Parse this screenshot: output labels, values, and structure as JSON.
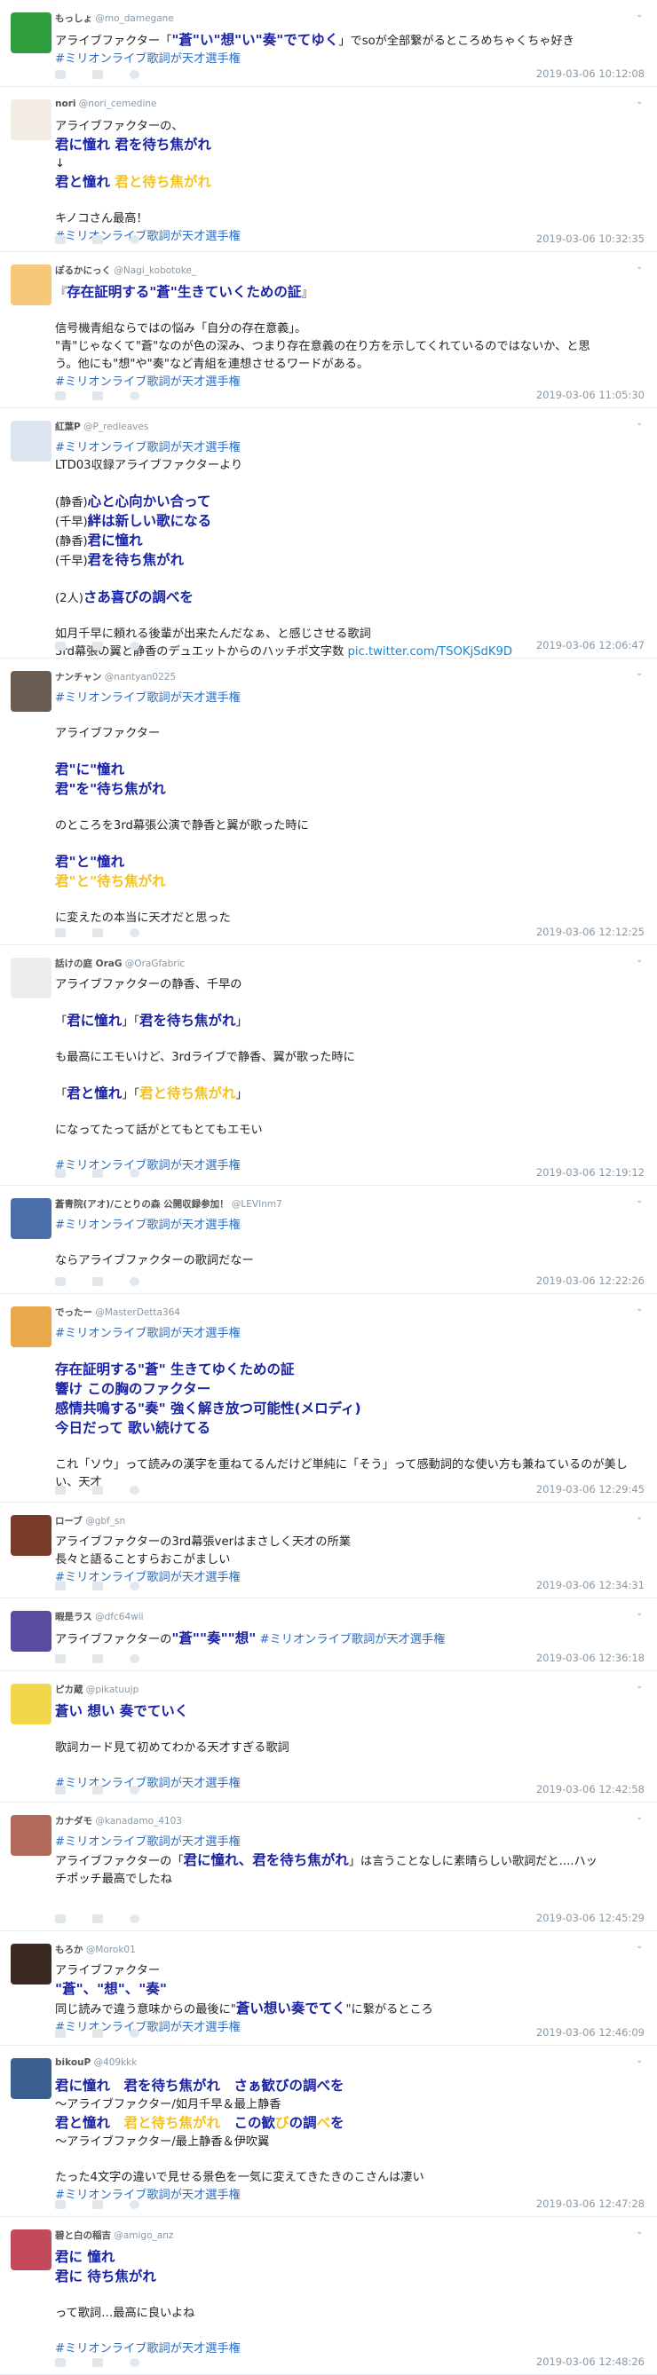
{
  "timeline": {
    "tweets": [
      {
        "user_name": "もっしょ",
        "user_handle": "@mo_damegane",
        "avatar_color": "#2e9d3e",
        "lines": [
          [
            {
              "t": "アライブファクター「"
            },
            {
              "t": "\"蒼\"い\"想\"い\"奏\"でてゆく",
              "s": "blue"
            },
            {
              "t": "」でsoが全部繋がるところめちゃくちゃ好き"
            }
          ],
          [
            {
              "t": "#ミリオンライブ歌詞が天才選手権",
              "s": "tag"
            }
          ]
        ],
        "timestamp": "2019-03-06 10:12:08"
      },
      {
        "user_name": "nori",
        "user_handle": "@nori_cemedine",
        "avatar_color": "#f3ede6",
        "lines": [
          [
            {
              "t": "アライブファクターの、"
            }
          ],
          [
            {
              "t": "君に憧れ 君を待ち焦がれ",
              "s": "blue"
            }
          ],
          [
            {
              "t": "↓"
            }
          ],
          [
            {
              "t": "君と憧れ ",
              "s": "blue"
            },
            {
              "t": "君と待ち焦がれ",
              "s": "yel"
            }
          ],
          [
            {
              "t": ""
            }
          ],
          [
            {
              "t": "キノコさん最高！"
            }
          ],
          [
            {
              "t": "#ミリオンライブ歌詞が天才選手権",
              "s": "tag"
            }
          ]
        ],
        "timestamp": "2019-03-06 10:32:35"
      },
      {
        "user_name": "ぽるかにっく",
        "user_handle": "@Nagi_kobotoke_",
        "avatar_color": "#f6c97a",
        "lines": [
          [
            {
              "t": "『"
            },
            {
              "t": "存在証明する\"蒼\"生きていくための証",
              "s": "blue"
            },
            {
              "t": "』"
            }
          ],
          [
            {
              "t": ""
            }
          ],
          [
            {
              "t": "信号機青組ならではの悩み「自分の存在意義」。"
            }
          ],
          [
            {
              "t": "\"青\"じゃなくて\"蒼\"なのが色の深み、つまり存在意義の在り方を示してくれているのではないか、と思"
            }
          ],
          [
            {
              "t": "う。他にも\"想\"や\"奏\"など青組を連想させるワードがある。"
            }
          ],
          [
            {
              "t": " #ミリオンライブ歌詞が天才選手権",
              "s": "tag"
            }
          ]
        ],
        "timestamp": "2019-03-06 11:05:30"
      },
      {
        "user_name": "紅葉P",
        "user_handle": "@P_redleaves",
        "avatar_color": "#dbe4ef",
        "lines": [
          [
            {
              "t": "#ミリオンライブ歌詞が天才選手権",
              "s": "tag"
            }
          ],
          [
            {
              "t": "LTD03収録アライブファクターより"
            }
          ],
          [
            {
              "t": ""
            }
          ],
          [
            {
              "t": "(静香)"
            },
            {
              "t": "心と心向かい合って",
              "s": "blue"
            }
          ],
          [
            {
              "t": "(千早)"
            },
            {
              "t": "絆は新しい歌になる",
              "s": "blue"
            }
          ],
          [
            {
              "t": "(静香)"
            },
            {
              "t": "君に憧れ",
              "s": "blue"
            }
          ],
          [
            {
              "t": "(千早)"
            },
            {
              "t": "君を待ち焦がれ",
              "s": "blue"
            }
          ],
          [
            {
              "t": ""
            }
          ],
          [
            {
              "t": "(2人)"
            },
            {
              "t": "さあ喜びの調べを",
              "s": "blue"
            }
          ],
          [
            {
              "t": ""
            }
          ],
          [
            {
              "t": "如月千早に頼れる後輩が出来たんだなぁ、と感じさせる歌詞"
            }
          ],
          [
            {
              "t": "3rd幕張の翼と静香のデュエットからのハッチポ文字数 "
            },
            {
              "t": "pic.twitter.com/TSOKjSdK9D",
              "s": "link"
            }
          ]
        ],
        "timestamp": "2019-03-06 12:06:47"
      },
      {
        "user_name": "ナンチャン",
        "user_handle": "@nantyan0225",
        "avatar_color": "#6b5c52",
        "lines": [
          [
            {
              "t": "#ミリオンライブ歌詞が天才選手権",
              "s": "tag"
            }
          ],
          [
            {
              "t": ""
            }
          ],
          [
            {
              "t": "アライブファクター"
            }
          ],
          [
            {
              "t": ""
            }
          ],
          [
            {
              "t": "君\"に\"憧れ",
              "s": "blue"
            }
          ],
          [
            {
              "t": "君\"を\"待ち焦がれ",
              "s": "blue"
            }
          ],
          [
            {
              "t": ""
            }
          ],
          [
            {
              "t": "のところを3rd幕張公演で静香と翼が歌った時に"
            }
          ],
          [
            {
              "t": ""
            }
          ],
          [
            {
              "t": "君\"と\"憧れ",
              "s": "blue"
            }
          ],
          [
            {
              "t": "君\"と\"待ち焦がれ",
              "s": "yel"
            }
          ],
          [
            {
              "t": ""
            }
          ],
          [
            {
              "t": "に変えたの本当に天才だと思った"
            }
          ]
        ],
        "timestamp": "2019-03-06 12:12:25"
      },
      {
        "user_name": "話けの庭 OraG",
        "user_handle": "@OraGfabric",
        "avatar_color": "#ececec",
        "lines": [
          [
            {
              "t": "アライブファクターの静香、千早の"
            }
          ],
          [
            {
              "t": ""
            }
          ],
          [
            {
              "t": "「"
            },
            {
              "t": "君に憧れ",
              "s": "blue"
            },
            {
              "t": "」「"
            },
            {
              "t": "君を待ち焦がれ",
              "s": "blue"
            },
            {
              "t": "」"
            }
          ],
          [
            {
              "t": ""
            }
          ],
          [
            {
              "t": "も最高にエモいけど、3rdライブで静香、翼が歌った時に"
            }
          ],
          [
            {
              "t": ""
            }
          ],
          [
            {
              "t": "「"
            },
            {
              "t": "君と憧れ",
              "s": "blue"
            },
            {
              "t": "」「"
            },
            {
              "t": "君と待ち焦がれ",
              "s": "yel"
            },
            {
              "t": "」"
            }
          ],
          [
            {
              "t": ""
            }
          ],
          [
            {
              "t": "になってたって話がとてもとてもエモい"
            }
          ],
          [
            {
              "t": ""
            }
          ],
          [
            {
              "t": "#ミリオンライブ歌詞が天才選手権",
              "s": "tag"
            }
          ]
        ],
        "timestamp": "2019-03-06 12:19:12"
      },
      {
        "user_name": "蒼青院(アオ)/ことりの森 公開収録参加！",
        "user_handle": "@LEVInm7",
        "avatar_color": "#4a6ea8",
        "lines": [
          [
            {
              "t": "#ミリオンライブ歌詞が天才選手権",
              "s": "tag"
            }
          ],
          [
            {
              "t": ""
            }
          ],
          [
            {
              "t": "ならアライブファクターの歌詞だなー"
            }
          ]
        ],
        "timestamp": "2019-03-06 12:22:26"
      },
      {
        "user_name": "でったー",
        "user_handle": "@MasterDetta364",
        "avatar_color": "#e8a94a",
        "lines": [
          [
            {
              "t": "#ミリオンライブ歌詞が天才選手権",
              "s": "tag"
            }
          ],
          [
            {
              "t": ""
            }
          ],
          [
            {
              "t": "存在証明する\"蒼\" 生きてゆくための証",
              "s": "blue"
            }
          ],
          [
            {
              "t": "響け この胸のファクター",
              "s": "blue"
            }
          ],
          [
            {
              "t": "感情共鳴する\"奏\" 強く解き放つ可能性(メロディ)",
              "s": "blue"
            }
          ],
          [
            {
              "t": "今日だって 歌い続けてる",
              "s": "blue"
            }
          ],
          [
            {
              "t": ""
            }
          ],
          [
            {
              "t": "これ「ソウ」って読みの漢字を重ねてるんだけど単純に「そう」って感動詞的な使い方も兼ねているのが美し"
            }
          ],
          [
            {
              "t": "い、天才"
            }
          ]
        ],
        "timestamp": "2019-03-06 12:29:45"
      },
      {
        "user_name": "ローブ",
        "user_handle": "@gbf_sn",
        "avatar_color": "#7a3a2a",
        "lines": [
          [
            {
              "t": "アライブファクターの3rd幕張verはまさしく天才の所業"
            }
          ],
          [
            {
              "t": "長々と語ることすらおこがましい"
            }
          ],
          [
            {
              "t": "#ミリオンライブ歌詞が天才選手権",
              "s": "tag"
            }
          ]
        ],
        "timestamp": "2019-03-06 12:34:31"
      },
      {
        "user_name": "暇是ラス",
        "user_handle": "@dfc64wii",
        "avatar_color": "#5a4aa0",
        "lines": [
          [
            {
              "t": "アライブファクターの"
            },
            {
              "t": "\"蒼\"\"奏\"\"想\"",
              "s": "blue"
            },
            {
              "t": " "
            },
            {
              "t": "#ミリオンライブ歌詞が天才選手権",
              "s": "tag"
            }
          ]
        ],
        "timestamp": "2019-03-06 12:36:18"
      },
      {
        "user_name": "ピカ蔵",
        "user_handle": "@pikatuujp",
        "avatar_color": "#f2d64b",
        "lines": [
          [
            {
              "t": "蒼い 想い 奏でていく",
              "s": "blue"
            }
          ],
          [
            {
              "t": ""
            }
          ],
          [
            {
              "t": "歌詞カード見て初めてわかる天才すぎる歌詞"
            }
          ],
          [
            {
              "t": ""
            }
          ],
          [
            {
              "t": "#ミリオンライブ歌詞が天才選手権",
              "s": "tag"
            }
          ]
        ],
        "timestamp": "2019-03-06 12:42:58"
      },
      {
        "user_name": "カナダモ",
        "user_handle": "@kanadamo_4103",
        "avatar_color": "#b26a5a",
        "lines": [
          [
            {
              "t": "#ミリオンライブ歌詞が天才選手権",
              "s": "tag"
            }
          ],
          [
            {
              "t": "アライブファクターの「"
            },
            {
              "t": "君に憧れ、君を待ち焦がれ",
              "s": "blue"
            },
            {
              "t": "」は言うことなしに素晴らしい歌詞だと....ハッ"
            }
          ],
          [
            {
              "t": "チポッチ最高でしたね"
            }
          ]
        ],
        "timestamp": "2019-03-06 12:45:29"
      },
      {
        "user_name": "もろか",
        "user_handle": "@Morok01",
        "avatar_color": "#3a2a22",
        "lines": [
          [
            {
              "t": "アライブファクター"
            }
          ],
          [
            {
              "t": "\"蒼\"、\"想\"、\"奏\"",
              "s": "blue"
            }
          ],
          [
            {
              "t": "同じ読みで違う意味からの最後に\""
            },
            {
              "t": "蒼い想い奏でてく",
              "s": "blue"
            },
            {
              "t": "\"に繋がるところ"
            }
          ],
          [
            {
              "t": "#ミリオンライブ歌詞が天才選手権",
              "s": "tag"
            }
          ]
        ],
        "timestamp": "2019-03-06 12:46:09"
      },
      {
        "user_name": "bikouP",
        "user_handle": "@409kkk",
        "avatar_color": "#3b5f8f",
        "lines": [
          [
            {
              "t": "君に憧れ　君を待ち焦がれ　さぁ歓びの調べを",
              "s": "blue"
            }
          ],
          [
            {
              "t": "～アライブファクター/如月千早＆最上静香"
            }
          ],
          [
            {
              "t": "君と憧れ　",
              "s": "blue"
            },
            {
              "t": "君と待ち焦がれ",
              "s": "yel"
            },
            {
              "t": "　この歓",
              "s": "blue"
            },
            {
              "t": "び",
              "s": "yel"
            },
            {
              "t": "の調",
              "s": "blue"
            },
            {
              "t": "べ",
              "s": "yel"
            },
            {
              "t": "を",
              "s": "blue"
            }
          ],
          [
            {
              "t": "～アライブファクター/最上静香＆伊吹翼"
            }
          ],
          [
            {
              "t": ""
            }
          ],
          [
            {
              "t": "たった4文字の違いで見せる景色を一気に変えてきたきのこさんは凄い"
            }
          ],
          [
            {
              "t": "#ミリオンライブ歌詞が天才選手権",
              "s": "tag"
            }
          ]
        ],
        "timestamp": "2019-03-06 12:47:28"
      },
      {
        "user_name": "碧と白の稲吉",
        "user_handle": "@amigo_anz",
        "avatar_color": "#c24a5a",
        "lines": [
          [
            {
              "t": "君に 憧れ",
              "s": "blue"
            }
          ],
          [
            {
              "t": "君に 待ち焦がれ",
              "s": "blue"
            }
          ],
          [
            {
              "t": ""
            }
          ],
          [
            {
              "t": "って歌詞…最高に良いよね"
            }
          ],
          [
            {
              "t": ""
            }
          ],
          [
            {
              "t": " #ミリオンライブ歌詞が天才選手権",
              "s": "tag"
            }
          ]
        ],
        "timestamp": "2019-03-06 12:48:26"
      }
    ]
  }
}
